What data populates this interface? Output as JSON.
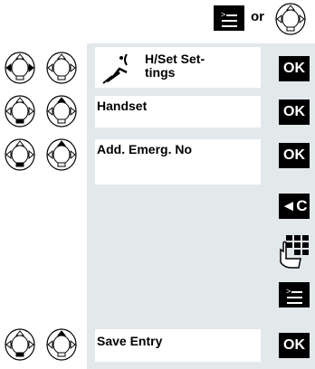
{
  "top": {
    "connector": "or"
  },
  "rows": [
    {
      "label_line1": "H/Set Set-",
      "label_line2": "tings",
      "key": "OK"
    },
    {
      "label": "Handset",
      "key": "OK"
    },
    {
      "label": "Add. Emerg. No",
      "key": "OK"
    },
    {
      "key": "◄C"
    },
    {
      "icon": "keypad-icon"
    },
    {
      "icon": "menu-icon"
    },
    {
      "label": "Save Entry",
      "key": "OK"
    }
  ],
  "colors": {
    "panel": "#e3e8eb",
    "key": "#000000",
    "keytext": "#ffffff"
  }
}
